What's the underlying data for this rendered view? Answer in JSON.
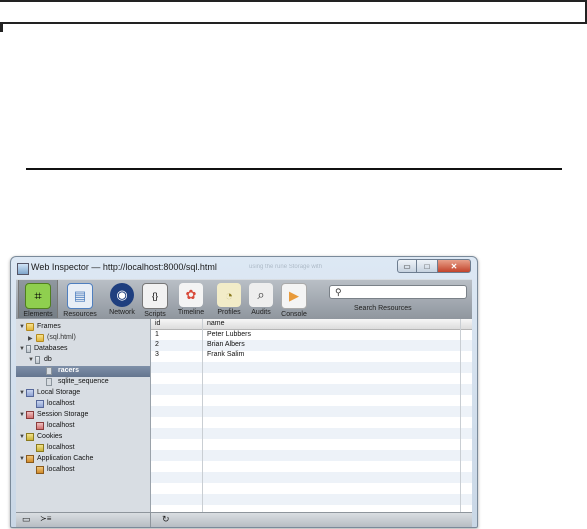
{
  "window": {
    "title": "Web Inspector — http://localhost:8000/sql.html",
    "ghost_title": "using the rune Storage with",
    "buttons": {
      "minimize": "▭",
      "maximize": "□",
      "close": "✕"
    }
  },
  "toolbar": {
    "tools": [
      {
        "label": "Elements",
        "icon": "elements-icon",
        "glyph": "⌗",
        "color": "#7fbf3f",
        "selected": true
      },
      {
        "label": "Resources",
        "icon": "resources-icon",
        "glyph": "▤",
        "color": "#4f7fbf"
      },
      {
        "label": "Network",
        "icon": "network-icon",
        "glyph": "◉",
        "color": "#2c4f8f"
      },
      {
        "label": "Scripts",
        "icon": "scripts-icon",
        "glyph": "{}",
        "color": "#e8e8e8"
      },
      {
        "label": "Timeline",
        "icon": "timeline-icon",
        "glyph": "✿",
        "color": "#d84a3a"
      },
      {
        "label": "Profiles",
        "icon": "profiles-icon",
        "glyph": "◔",
        "color": "#e8d87a"
      },
      {
        "label": "Audits",
        "icon": "audits-icon",
        "glyph": "⌕",
        "color": "#e8e8e8"
      },
      {
        "label": "Console",
        "icon": "console-icon",
        "glyph": "▶",
        "color": "#e89a3a"
      }
    ],
    "search": {
      "placeholder": "",
      "label": "Search Resources",
      "icon": "search-icon"
    }
  },
  "sidebar": {
    "frames": {
      "label": "Frames",
      "child": "(sql.html)"
    },
    "databases": {
      "label": "Databases",
      "db": "db",
      "tables": [
        "racers",
        "sqlite_sequence"
      ],
      "selected": "racers"
    },
    "local_storage": {
      "label": "Local Storage",
      "child": "localhost"
    },
    "session_storage": {
      "label": "Session Storage",
      "child": "localhost"
    },
    "cookies": {
      "label": "Cookies",
      "child": "localhost"
    },
    "app_cache": {
      "label": "Application Cache",
      "child": "localhost"
    }
  },
  "grid": {
    "columns": [
      "id",
      "name"
    ],
    "rows": [
      {
        "id": "1",
        "name": "Peter Lubbers"
      },
      {
        "id": "2",
        "name": "Brian Albers"
      },
      {
        "id": "3",
        "name": "Frank Salim"
      }
    ]
  },
  "statusbar": {
    "dock_icon": "dock-icon",
    "console_icon": "console-toggle-icon",
    "refresh_icon": "refresh-icon",
    "console_glyph": "≻≡",
    "refresh_glyph": "↻"
  }
}
